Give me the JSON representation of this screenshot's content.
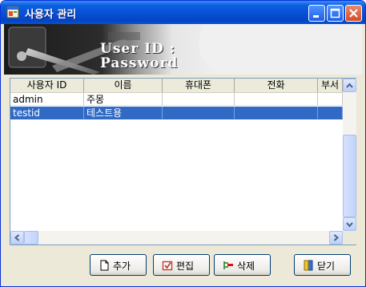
{
  "window": {
    "title": "사용자 관리"
  },
  "banner": {
    "line1": "User ID :",
    "line2": "Password"
  },
  "table": {
    "columns": [
      "사용자 ID",
      "이름",
      "휴대폰",
      "전화",
      "부서"
    ],
    "rows": [
      {
        "id": "admin",
        "name": "주몽",
        "mobile": "",
        "phone": "",
        "dept": ""
      },
      {
        "id": "testid",
        "name": "테스트용",
        "mobile": "",
        "phone": "",
        "dept": ""
      }
    ],
    "selected_row": 1
  },
  "buttons": {
    "add": "추가",
    "edit": "편집",
    "delete": "삭제",
    "close": "닫기"
  },
  "icons": {
    "app": "app-window-icon",
    "minimize": "minimize-icon",
    "maximize": "maximize-icon",
    "close": "close-icon",
    "add": "new-document-icon",
    "edit": "checkbox-edit-icon",
    "delete": "delete-row-icon",
    "exit": "exit-door-icon"
  },
  "colors": {
    "titlebar": "#0a5fe0",
    "selection": "#316ac5",
    "close_button": "#d64a26"
  }
}
